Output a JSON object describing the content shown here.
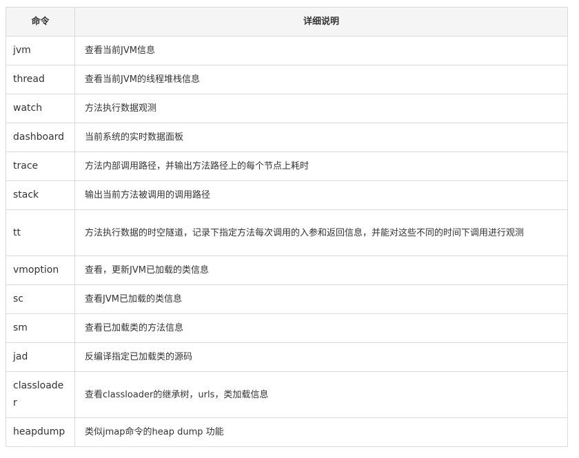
{
  "header": {
    "col_command": "命令",
    "col_description": "详细说明"
  },
  "rows": [
    {
      "command": "jvm",
      "description": "查看当前JVM信息"
    },
    {
      "command": "thread",
      "description": "查看当前JVM的线程堆栈信息"
    },
    {
      "command": "watch",
      "description": "方法执行数据观测"
    },
    {
      "command": "dashboard",
      "description": "当前系统的实时数据面板"
    },
    {
      "command": "trace",
      "description": "方法内部调用路径，并输出方法路径上的每个节点上耗时"
    },
    {
      "command": "stack",
      "description": "输出当前方法被调用的调用路径"
    },
    {
      "command": "tt",
      "description": "方法执行数据的时空隧道，记录下指定方法每次调用的入参和返回信息，并能对这些不同的时间下调用进行观测"
    },
    {
      "command": "vmoption",
      "description": "查看，更新JVM已加载的类信息"
    },
    {
      "command": "sc",
      "description": "查看JVM已加载的类信息"
    },
    {
      "command": "sm",
      "description": "查看已加载类的方法信息"
    },
    {
      "command": "jad",
      "description": "反编译指定已加载类的源码"
    },
    {
      "command": "classloader",
      "description": "查看classloader的继承树，urls，类加载信息"
    },
    {
      "command": "heapdump",
      "description": "类似jmap命令的heap dump 功能"
    }
  ]
}
